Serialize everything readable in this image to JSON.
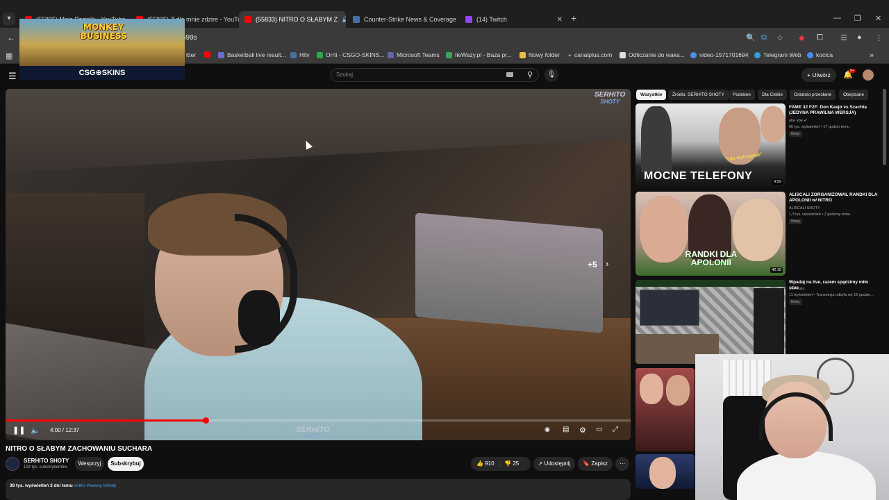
{
  "browser": {
    "tabs": [
      {
        "label": "(55825) Moje Portalik - YouTube",
        "fav": "#ff0000"
      },
      {
        "label": "(55825) Z dla mnie zdzire - YouTube",
        "fav": "#ff0000"
      },
      {
        "label": "(55833) NITRO O SŁABYM Z",
        "fav": "#ff0000"
      },
      {
        "label": "Counter-Strike News & Coverage",
        "fav": "#4a6fa5"
      },
      {
        "label": "(14) Twitch",
        "fav": "#9146ff"
      }
    ],
    "url_fragment": "599s",
    "bookmarks": [
      {
        "label": "itter",
        "color": "#888"
      },
      {
        "label": "Basketball live result...",
        "color": "#6b6bd6"
      },
      {
        "label": "Hltv",
        "color": "#4a6fa5"
      },
      {
        "label": "Orrti - CSGO-SKINS...",
        "color": "#2eaa4a"
      },
      {
        "label": "Microsoft Teams",
        "color": "#6264a7"
      },
      {
        "label": "IleWazy.pl - Baza pr...",
        "color": "#3aa55b"
      },
      {
        "label": "Nowy folder",
        "color": "#e8c04a"
      },
      {
        "label": "canalplus.com",
        "color": "#ffffff"
      },
      {
        "label": "Odliczanie do waka...",
        "color": "#dddddd"
      },
      {
        "label": "video-1571701694",
        "color": "#4b8bf5"
      },
      {
        "label": "Telegram Web",
        "color": "#2aa3e0"
      },
      {
        "label": "kocica",
        "color": "#4b8bf5"
      }
    ]
  },
  "ad": {
    "title": "MONKEY BUSINESS",
    "brand": "CSG⊕SKINS"
  },
  "header": {
    "search_placeholder": "Szukaj",
    "create_label": "+ Utwórz",
    "notification_badge": "9+"
  },
  "player": {
    "watermark_main": "SERHITO",
    "watermark_sub": "SHOTY",
    "endscreen_more": "+5",
    "timecode": "4:00 / 12:37",
    "progress_percent": 32
  },
  "video": {
    "title": "NITRO O SŁABYM ZACHOWANIU SUCHARA",
    "channel": "SERHITO SHOTY",
    "subscribers": "134 tys. subskrybentów",
    "support_label": "Wesprzyj",
    "subscribe_label": "Subskrybuj",
    "likes": "910",
    "dislikes": "25",
    "share_label": "Udostępnij",
    "save_label": "Zapisz",
    "desc_stats": "38 tys. wyświetleń  3 dni temu",
    "desc_tags": "#nitro #newsy #shoty"
  },
  "sidebar": {
    "chips": [
      "Wszystkie",
      "Źródło: SERHITO SHOTY",
      "Podobne",
      "Dla Ciebie",
      "Ostatnio przesłane",
      "Obejrzane"
    ],
    "videos": [
      {
        "title": "FAME 32 F2F: Don Kasjo vs Szachta (JEDYNA PRAWILNA WERSJA)",
        "channel": "ebe ebe",
        "meta": "56 tys. wyświetleń • 17 godzin temu",
        "badge": "Nowy",
        "thumb_text": "MOCNE TELEFONY",
        "thumb_quote": "\"nie wytrzymał\"",
        "duration": "9:59"
      },
      {
        "title": "ALISCALI ZORGANIZOWAŁ RANDKI DLA APOLONII w/ NITRO",
        "channel": "ALISCALI SHOTY",
        "meta": "1,3 tys. wyświetleń • 2 godziny temu",
        "badge": "Nowy",
        "thumb_text": "RANDKI DLA APOLONII",
        "duration": "42:15"
      },
      {
        "title": "Wpadaj na live, razem spędzimy miło czas",
        "channel": "Morfeusz",
        "meta": "11 wyświetleń • Transmisja odbyła się 16 godzin...",
        "badge": "Nowy"
      }
    ]
  }
}
